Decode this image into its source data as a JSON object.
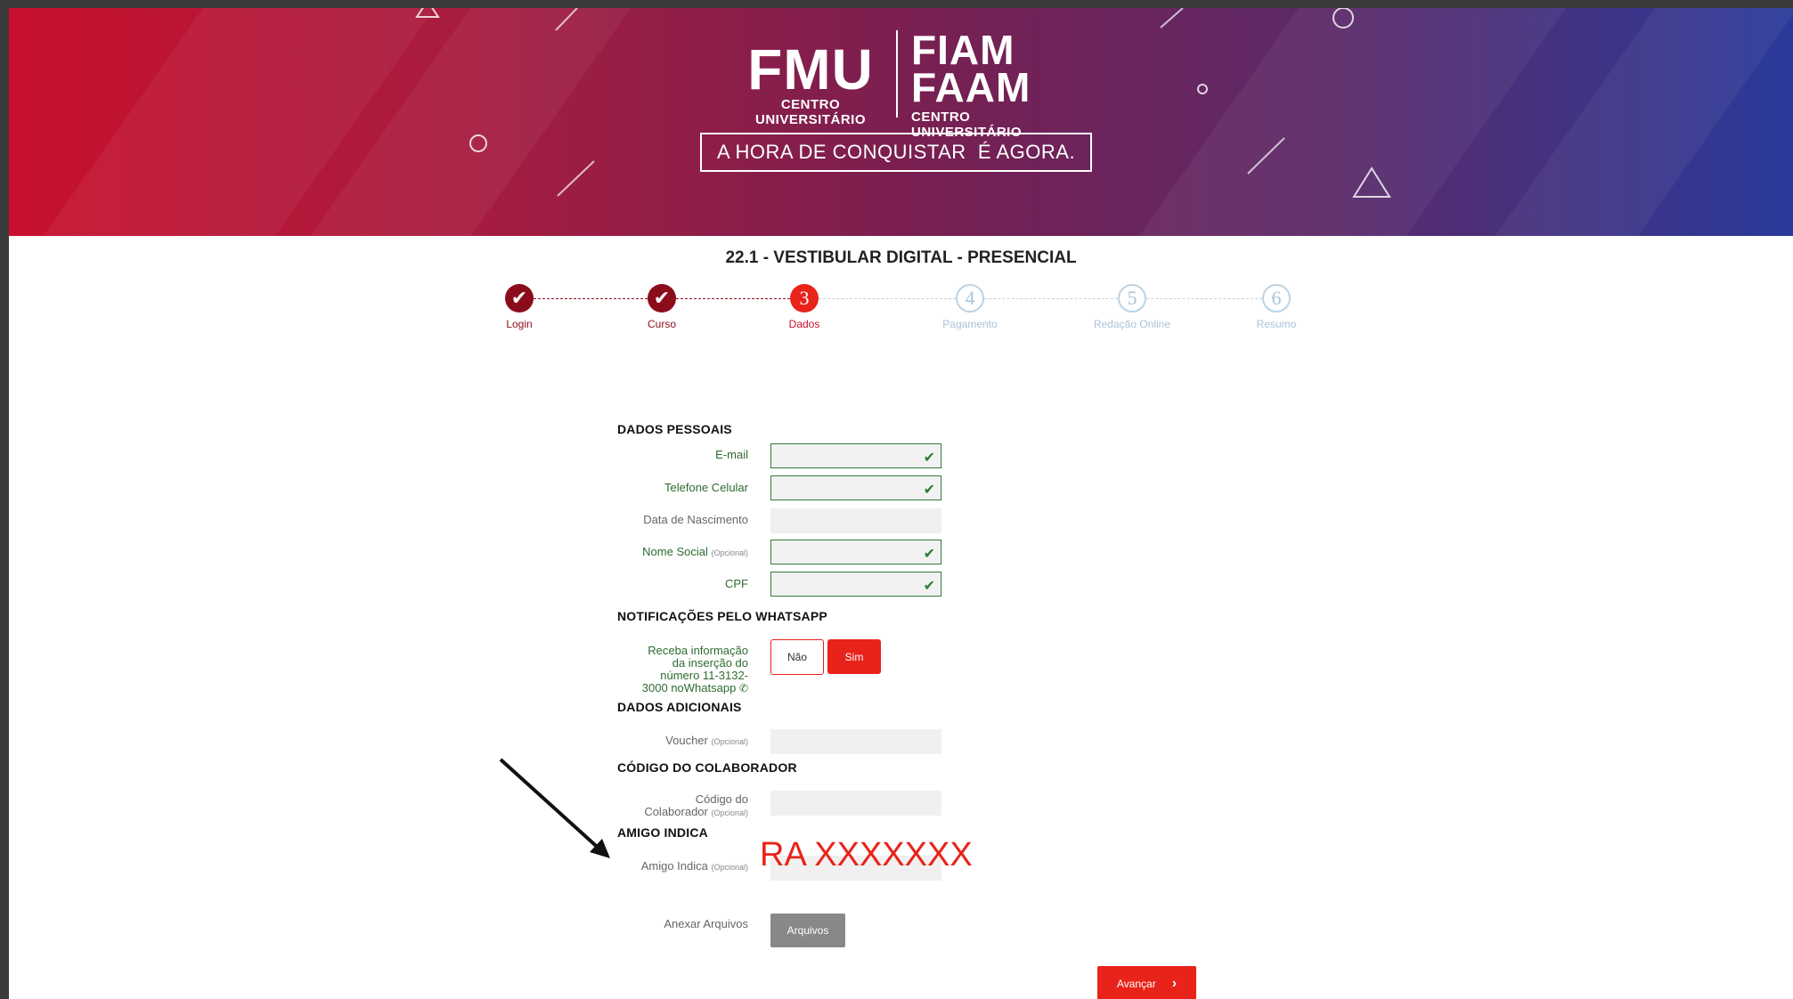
{
  "header": {
    "logo_left_big": "FMU",
    "logo_left_small": "CENTRO UNIVERSITÁRIO",
    "logo_right_line1": "FIAM",
    "logo_right_line2": "FAAM",
    "logo_right_small": "CENTRO UNIVERSITÁRIO",
    "tagline": "A HORA DE CONQUISTAR  É AGORA."
  },
  "page_title": "22.1 - VESTIBULAR DIGITAL - PRESENCIAL",
  "steps": [
    {
      "number": "",
      "label": "Login",
      "state": "done"
    },
    {
      "number": "",
      "label": "Curso",
      "state": "done"
    },
    {
      "number": "3",
      "label": "Dados",
      "state": "current"
    },
    {
      "number": "4",
      "label": "Pagamento",
      "state": "future"
    },
    {
      "number": "5",
      "label": "Redação Online",
      "state": "future"
    },
    {
      "number": "6",
      "label": "Resumo",
      "state": "future"
    }
  ],
  "sections": {
    "personal": "DADOS PESSOAIS",
    "whatsapp": "NOTIFICAÇÕES PELO WHATSAPP",
    "additional": "DADOS ADICIONAIS",
    "collaborator": "CÓDIGO DO COLABORADOR",
    "friend": "AMIGO INDICA"
  },
  "fields": {
    "email": {
      "label": "E-mail",
      "value": ""
    },
    "phone": {
      "label": "Telefone Celular",
      "value": ""
    },
    "birth": {
      "label": "Data de Nascimento",
      "value": ""
    },
    "social_name": {
      "label": "Nome Social",
      "optional": "(Opcional)",
      "value": ""
    },
    "cpf": {
      "label": "CPF",
      "value": ""
    },
    "voucher": {
      "label": "Voucher",
      "optional": "(Opcional)",
      "value": ""
    },
    "collab_code": {
      "label_line1": "Código do",
      "label_line2": "Colaborador",
      "optional": "(Opcional)",
      "value": ""
    },
    "friend": {
      "label": "Amigo Indica",
      "optional": "(Opcional)",
      "value": ""
    },
    "attach": {
      "label": "Anexar Arquivos"
    }
  },
  "whatsapp": {
    "text_line1": "Receba informação",
    "text_line2": "da inserção do",
    "text_line3": "número 11-3132-",
    "text_line4": "3000 noWhatsapp",
    "no_label": "Não",
    "yes_label": "Sim"
  },
  "buttons": {
    "files": "Arquivos",
    "next": "Avançar"
  },
  "annotation": {
    "text": "RA XXXXXXX"
  },
  "colors": {
    "accent": "#e8231a",
    "done": "#8b0d1c",
    "valid": "#2f7d32"
  }
}
